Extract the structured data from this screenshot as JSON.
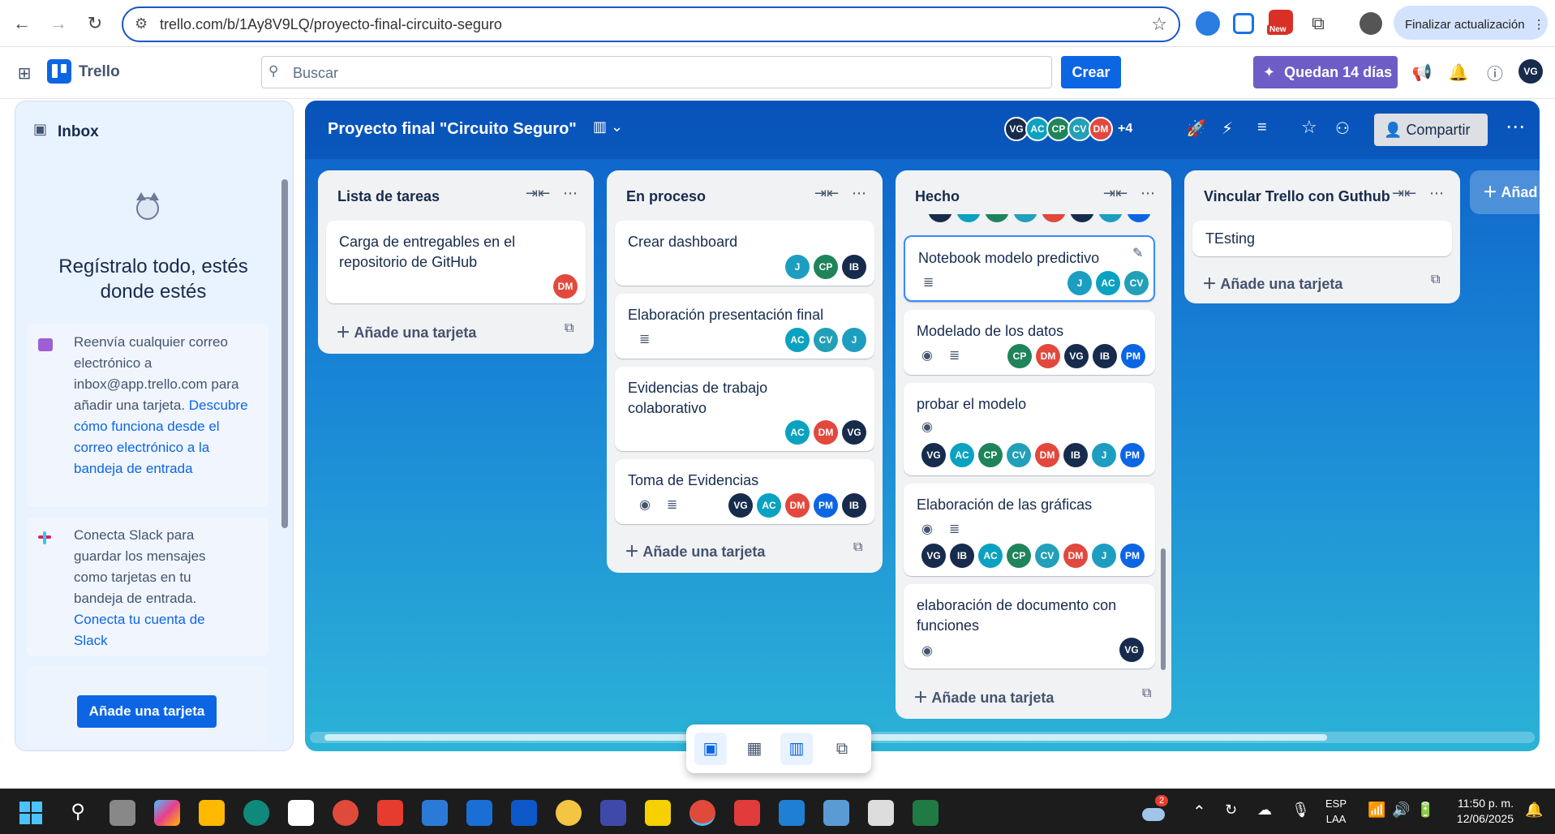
{
  "browser": {
    "url": "trello.com/b/1Ay8V9LQ/proyecto-final-circuito-seguro",
    "update_label": "Finalizar actualización",
    "new_badge": "New"
  },
  "header": {
    "app_name": "Trello",
    "search_placeholder": "Buscar",
    "create_label": "Crear",
    "trial_label": "Quedan 14 días",
    "user_initials": "VG"
  },
  "inbox": {
    "title": "Inbox",
    "heading": "Regístralo todo, estés donde estés",
    "email_text": "Reenvía cualquier correo electrónico a inbox@app.trello.com para añadir una tarjeta.",
    "email_link": "Descubre cómo funciona desde el correo electrónico a la bandeja de entrada",
    "slack_text": "Conecta Slack para guardar los mensajes como tarjetas en tu bandeja de entrada.",
    "slack_link": "Conecta tu cuenta de Slack",
    "add_button": "Añade una tarjeta"
  },
  "board": {
    "title": "Proyecto final \"Circuito Seguro\"",
    "members": [
      "VG",
      "AC",
      "CP",
      "CV",
      "DM"
    ],
    "more_members": "+4",
    "share_label": "Compartir"
  },
  "member_colors": {
    "VG": "#172b4d",
    "AC": "#0aa2c0",
    "CP": "#1f845a",
    "CV": "#22a0b8",
    "DM": "#e2483d",
    "IB": "#172b4d",
    "J": "#1d9ec0",
    "PM": "#0c66e4"
  },
  "lists": [
    {
      "title": "Lista de tareas",
      "add_label": "Añade una tarjeta",
      "cards": [
        {
          "title": "Carga de entregables en el repositorio de GitHub",
          "members": [
            "DM"
          ]
        }
      ]
    },
    {
      "title": "En proceso",
      "add_label": "Añade una tarjeta",
      "cards": [
        {
          "title": "Crear dashboard",
          "members": [
            "J",
            "CP",
            "IB"
          ]
        },
        {
          "title": "Elaboración presentación final",
          "members": [
            "AC",
            "CV",
            "J"
          ]
        },
        {
          "title": "Evidencias de trabajo colaborativo",
          "members": [
            "AC",
            "DM",
            "VG"
          ]
        },
        {
          "title": "Toma de Evidencias",
          "members": [
            "VG",
            "AC",
            "DM",
            "PM",
            "IB"
          ]
        }
      ]
    },
    {
      "title": "Hecho",
      "add_label": "Añade una tarjeta",
      "cards": [
        {
          "title": "Notebook modelo predictivo",
          "members": [
            "J",
            "AC",
            "CV"
          ]
        },
        {
          "title": "Modelado de los datos",
          "members": [
            "CP",
            "DM",
            "VG",
            "IB",
            "PM"
          ]
        },
        {
          "title": "probar el modelo",
          "members": [
            "VG",
            "AC",
            "CP",
            "CV",
            "DM",
            "IB",
            "J",
            "PM"
          ]
        },
        {
          "title": "Elaboración de las gráficas",
          "members": [
            "VG",
            "IB",
            "AC",
            "CP",
            "CV",
            "DM",
            "J",
            "PM"
          ]
        },
        {
          "title": "elaboración de documento con funciones",
          "members": [
            "VG"
          ]
        }
      ]
    },
    {
      "title": "Vincular Trello con Guthub",
      "add_label": "Añade una tarjeta",
      "cards": [
        {
          "title": "TEsting",
          "members": []
        }
      ]
    }
  ],
  "add_list_label": "Añad",
  "taskbar": {
    "weather_badge": "2",
    "lang_top": "ESP",
    "lang_bottom": "LAA",
    "time": "11:50 p. m.",
    "date": "12/06/2025"
  }
}
